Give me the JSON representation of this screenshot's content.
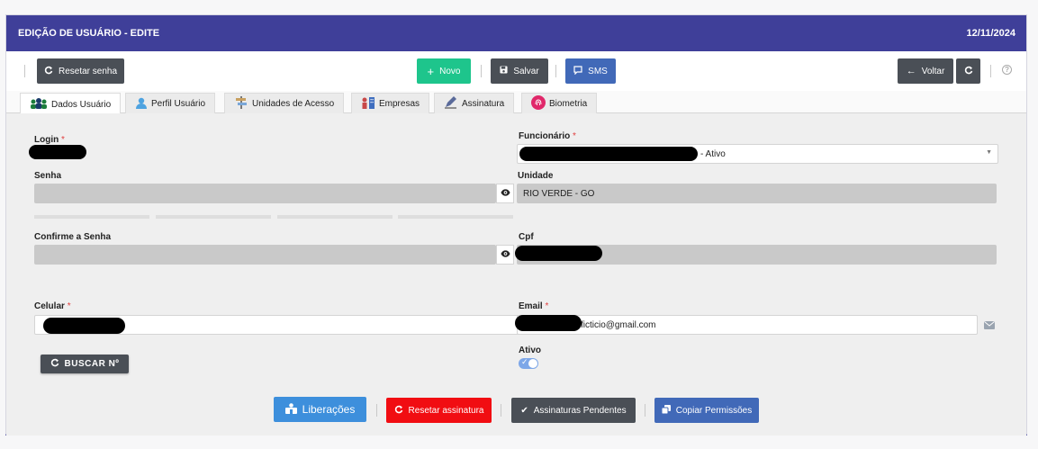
{
  "header": {
    "title": "EDIÇÃO DE USUÁRIO - EDITE",
    "date": "12/11/2024"
  },
  "toolbar": {
    "reset_password": "Resetar senha",
    "new": "Novo",
    "save": "Salvar",
    "sms": "SMS",
    "back": "Voltar",
    "help": "?"
  },
  "tabs": [
    {
      "label": "Dados Usuário"
    },
    {
      "label": "Perfil Usuário"
    },
    {
      "label": "Unidades de Acesso"
    },
    {
      "label": "Empresas"
    },
    {
      "label": "Assinatura"
    },
    {
      "label": "Biometria"
    }
  ],
  "form": {
    "login_label": "Login",
    "funcionario_label": "Funcionário",
    "funcionario_suffix": "- Ativo",
    "senha_label": "Senha",
    "unidade_label": "Unidade",
    "unidade_value": "RIO VERDE - GO",
    "confirm_label": "Confirme a Senha",
    "cpf_label": "Cpf",
    "celular_label": "Celular",
    "email_label": "Email",
    "email_suffix": "ficticio@gmail.com",
    "ativo_label": "Ativo",
    "buscar_label": "BUSCAR Nº",
    "required_mark": "*"
  },
  "actions": {
    "liberacoes": "Liberações",
    "reset_signature": "Resetar assinatura",
    "pending_signatures": "Assinaturas Pendentes",
    "copy_permissions": "Copiar Permissões"
  },
  "colors": {
    "header": "#3f3f99",
    "novo": "#1ec58c",
    "sms": "#4169b8",
    "reset_signature": "#f10d12"
  }
}
